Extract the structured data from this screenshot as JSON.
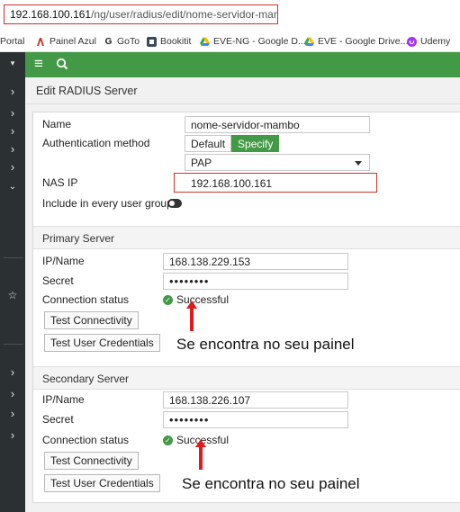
{
  "browser": {
    "url_host": "192.168.100.161",
    "url_path": "/ng/user/radius/edit/nome-servidor-mambo"
  },
  "bookmarks": [
    {
      "label": "Portal",
      "icon": "none"
    },
    {
      "label": "Painel Azul",
      "icon": "painel-azul-icon"
    },
    {
      "label": "GoTo",
      "icon": "goto-icon"
    },
    {
      "label": "Bookitit",
      "icon": "bookitit-icon"
    },
    {
      "label": "EVE-NG - Google D...",
      "icon": "google-drive-icon"
    },
    {
      "label": "EVE - Google Drive...",
      "icon": "google-drive-icon"
    },
    {
      "label": "Udemy",
      "icon": "udemy-icon"
    }
  ],
  "colors": {
    "accent": "#439a46",
    "highlight": "#d0312d",
    "arrow": "#e01b1b",
    "sidebar": "#2b3033"
  },
  "page": {
    "title": "Edit RADIUS Server"
  },
  "form": {
    "name_label": "Name",
    "name_value": "nome-servidor-mambo",
    "auth_label": "Authentication method",
    "auth_options": [
      "Default",
      "Specify"
    ],
    "auth_selected": "Specify",
    "auth_protocol": "PAP",
    "nas_ip_label": "NAS IP",
    "nas_ip_value": "192.168.100.161",
    "include_label": "Include in every user group",
    "include_enabled": false
  },
  "primary": {
    "title": "Primary Server",
    "ip_label": "IP/Name",
    "ip_value": "168.138.229.153",
    "secret_label": "Secret",
    "secret_value": "••••••••",
    "status_label": "Connection status",
    "status_value": "Successful",
    "test_conn": "Test Connectivity",
    "test_user": "Test User Credentials",
    "annotation": "Se encontra no seu painel"
  },
  "secondary": {
    "title": "Secondary Server",
    "ip_label": "IP/Name",
    "ip_value": "168.138.226.107",
    "secret_label": "Secret",
    "secret_value": "••••••••",
    "status_label": "Connection status",
    "status_value": "Successful",
    "test_conn": "Test Connectivity",
    "test_user": "Test User Credentials",
    "annotation": "Se encontra no seu painel"
  }
}
